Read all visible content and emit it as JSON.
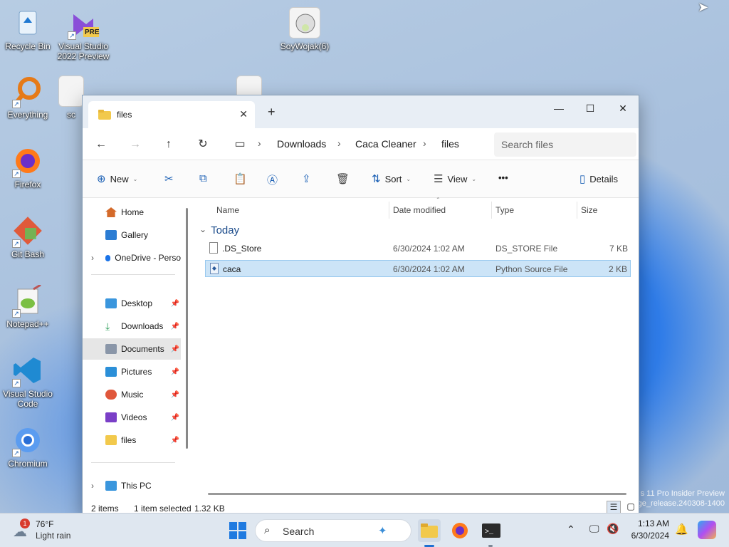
{
  "desktop": {
    "icons": [
      {
        "label": "Recycle Bin",
        "icon": "recycle-bin-icon"
      },
      {
        "label": "Visual Studio 2022 Preview",
        "icon": "visual-studio-icon",
        "badge": "PRE"
      },
      {
        "label": "SoyWojak(6)",
        "icon": "image-file-icon"
      },
      {
        "label": "Everything",
        "icon": "everything-icon"
      },
      {
        "label": "sc",
        "icon": "image-file-icon"
      },
      {
        "label": "Firefox",
        "icon": "firefox-icon"
      },
      {
        "label": "Git Bash",
        "icon": "git-bash-icon"
      },
      {
        "label": "Notepad++",
        "icon": "notepadpp-icon"
      },
      {
        "label": "Visual Studio Code",
        "icon": "vscode-icon"
      },
      {
        "label": "Chromium",
        "icon": "chromium-icon"
      }
    ],
    "watermark_line1": "s 11 Pro Insider Preview",
    "watermark_line2": "ge_release.240308-1400"
  },
  "explorer": {
    "tab_title": "files",
    "breadcrumb": [
      "Downloads",
      "Caca Cleaner",
      "files"
    ],
    "search_placeholder": "Search files",
    "toolbar": {
      "new": "New",
      "sort": "Sort",
      "view": "View",
      "more": "•••",
      "details": "Details"
    },
    "sidebar": {
      "items": [
        {
          "label": "Home",
          "icon": "home-icon",
          "color": "#d46a2a"
        },
        {
          "label": "Gallery",
          "icon": "gallery-icon",
          "color": "#2b7cd3"
        },
        {
          "label": "OneDrive - Perso",
          "icon": "onedrive-icon",
          "color": "#1a73e8"
        },
        {
          "label": "Desktop",
          "icon": "desktop-icon",
          "color": "#3a96dd"
        },
        {
          "label": "Downloads",
          "icon": "downloads-icon",
          "color": "#2e9e5b"
        },
        {
          "label": "Documents",
          "icon": "documents-icon",
          "color": "#8a96a8"
        },
        {
          "label": "Pictures",
          "icon": "pictures-icon",
          "color": "#2b8fd8"
        },
        {
          "label": "Music",
          "icon": "music-icon",
          "color": "#e0573b"
        },
        {
          "label": "Videos",
          "icon": "videos-icon",
          "color": "#7a3fc7"
        },
        {
          "label": "files",
          "icon": "folder-icon",
          "color": "#f2c94c"
        },
        {
          "label": "This PC",
          "icon": "this-pc-icon",
          "color": "#3a96dd"
        }
      ]
    },
    "columns": {
      "name": "Name",
      "date": "Date modified",
      "type": "Type",
      "size": "Size"
    },
    "group_label": "Today",
    "files": [
      {
        "name": ".DS_Store",
        "date": "6/30/2024 1:02 AM",
        "type": "DS_STORE File",
        "size": "7 KB"
      },
      {
        "name": "caca",
        "date": "6/30/2024 1:02 AM",
        "type": "Python Source File",
        "size": "2 KB"
      }
    ],
    "status": {
      "items": "2 items",
      "selected": "1 item selected",
      "size": "1.32 KB"
    }
  },
  "taskbar": {
    "weather_temp": "76°F",
    "weather_desc": "Light rain",
    "weather_badge": "1",
    "search_label": "Search",
    "time": "1:13 AM",
    "date": "6/30/2024"
  }
}
